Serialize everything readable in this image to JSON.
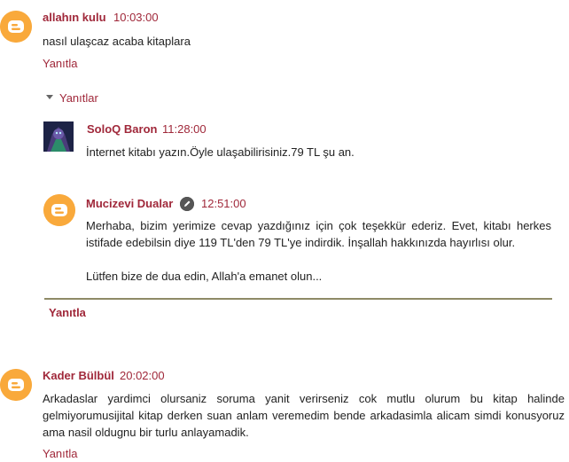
{
  "comments": [
    {
      "author": "allahın kulu",
      "time": "10:03:00",
      "text": "nasıl ulaşcaz acaba kitaplara",
      "reply_label": "Yanıtla"
    }
  ],
  "replies_toggle": "Yanıtlar",
  "replies": [
    {
      "author": "SoloQ Baron",
      "time": "11:28:00",
      "text": "İnternet kitabı yazın.Öyle ulaşabilirisiniz.79 TL şu an."
    },
    {
      "author": "Mucizevi Dualar",
      "time": "12:51:00",
      "text_p1": "Merhaba, bizim yerimize cevap yazdığınız için çok teşekkür ederiz. Evet, kitabı herkes istifade edebilsin diye 119 TL'den 79 TL'ye indirdik. İnşallah hakkınızda hayırlısı olur.",
      "text_p2": "Lütfen bize de dua edin, Allah'a emanet olun..."
    }
  ],
  "thread_reply_label": "Yanıtla",
  "comment2": {
    "author": "Kader Bülbül",
    "time": "20:02:00",
    "text": "Arkadaslar yardimci olursaniz soruma yanit verirseniz cok mutlu olurum bu kitap halinde gelmiyorumusijital kitap derken suan anlam veremedim bende arkadasimla alicam simdi konusyoruz ama nasil oldugnu bir turlu anlayamadik.",
    "reply_label": "Yanıtla"
  },
  "colors": {
    "accent": "#a0283a",
    "avatar": "#f9a93b",
    "divider": "#8e8a66"
  },
  "icons": {
    "avatar": "blogger-icon",
    "edit": "pencil-icon",
    "toggle": "caret-down-icon"
  }
}
